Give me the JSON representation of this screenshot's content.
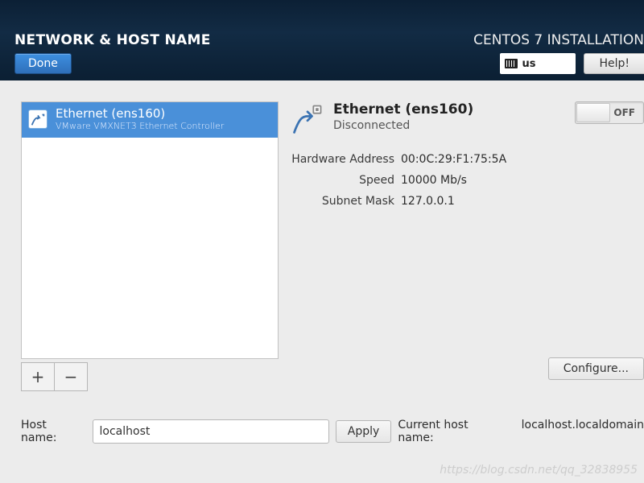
{
  "header": {
    "title": "NETWORK & HOST NAME",
    "install_title": "CENTOS 7 INSTALLATION",
    "done_label": "Done",
    "keyboard_layout": "us",
    "help_label": "Help!"
  },
  "network_list": {
    "items": [
      {
        "label": "Ethernet (ens160)",
        "sublabel": "VMware VMXNET3 Ethernet Controller"
      }
    ],
    "add_label": "+",
    "remove_label": "−"
  },
  "details": {
    "title": "Ethernet (ens160)",
    "status": "Disconnected",
    "toggle_state": "OFF",
    "props": {
      "hwaddr_label": "Hardware Address",
      "hwaddr_value": "00:0C:29:F1:75:5A",
      "speed_label": "Speed",
      "speed_value": "10000 Mb/s",
      "subnet_label": "Subnet Mask",
      "subnet_value": "127.0.0.1"
    },
    "configure_label": "Configure..."
  },
  "hostname": {
    "label": "Host name:",
    "value": "localhost",
    "apply_label": "Apply",
    "current_label": "Current host name:",
    "current_value": "localhost.localdomain"
  },
  "watermark": "https://blog.csdn.net/qq_32838955"
}
